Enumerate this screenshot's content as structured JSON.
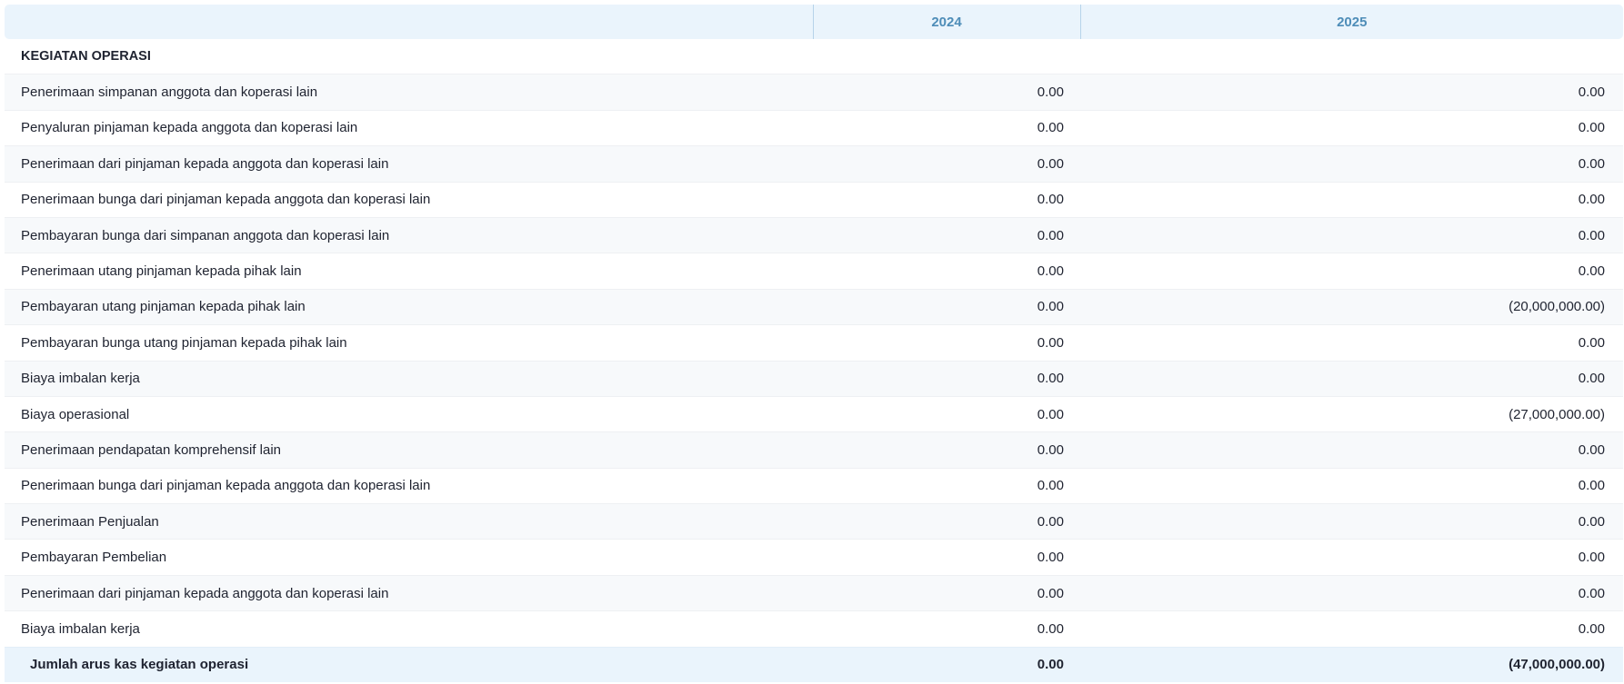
{
  "table": {
    "columns": [
      "",
      "2024",
      "2025"
    ],
    "section_title": "KEGIATAN OPERASI",
    "rows": [
      {
        "label": "Penerimaan simpanan anggota dan koperasi lain",
        "v2024": "0.00",
        "v2025": "0.00"
      },
      {
        "label": "Penyaluran pinjaman kepada anggota dan koperasi lain",
        "v2024": "0.00",
        "v2025": "0.00"
      },
      {
        "label": "Penerimaan dari pinjaman kepada anggota dan koperasi lain",
        "v2024": "0.00",
        "v2025": "0.00"
      },
      {
        "label": "Penerimaan bunga dari pinjaman kepada anggota dan koperasi lain",
        "v2024": "0.00",
        "v2025": "0.00"
      },
      {
        "label": "Pembayaran bunga dari simpanan anggota dan koperasi lain",
        "v2024": "0.00",
        "v2025": "0.00"
      },
      {
        "label": "Penerimaan utang pinjaman kepada pihak lain",
        "v2024": "0.00",
        "v2025": "0.00"
      },
      {
        "label": "Pembayaran utang pinjaman kepada pihak lain",
        "v2024": "0.00",
        "v2025": "(20,000,000.00)"
      },
      {
        "label": "Pembayaran bunga utang pinjaman kepada pihak lain",
        "v2024": "0.00",
        "v2025": "0.00"
      },
      {
        "label": "Biaya imbalan kerja",
        "v2024": "0.00",
        "v2025": "0.00"
      },
      {
        "label": "Biaya operasional",
        "v2024": "0.00",
        "v2025": "(27,000,000.00)"
      },
      {
        "label": "Penerimaan pendapatan komprehensif lain",
        "v2024": "0.00",
        "v2025": "0.00"
      },
      {
        "label": "Penerimaan bunga dari pinjaman kepada anggota dan koperasi lain",
        "v2024": "0.00",
        "v2025": "0.00"
      },
      {
        "label": "Penerimaan Penjualan",
        "v2024": "0.00",
        "v2025": "0.00"
      },
      {
        "label": "Pembayaran Pembelian",
        "v2024": "0.00",
        "v2025": "0.00"
      },
      {
        "label": "Penerimaan dari pinjaman kepada anggota dan koperasi lain",
        "v2024": "0.00",
        "v2025": "0.00"
      },
      {
        "label": "Biaya imbalan kerja",
        "v2024": "0.00",
        "v2025": "0.00"
      }
    ],
    "total": {
      "label": "Jumlah arus kas kegiatan operasi",
      "v2024": "0.00",
      "v2025": "(47,000,000.00)"
    }
  },
  "colors": {
    "header_bg": "#eaf4fc",
    "header_text": "#4e8db8",
    "row_alt_bg": "#f7f9fb",
    "total_bg": "#eaf4fc",
    "text": "#1f2330"
  }
}
